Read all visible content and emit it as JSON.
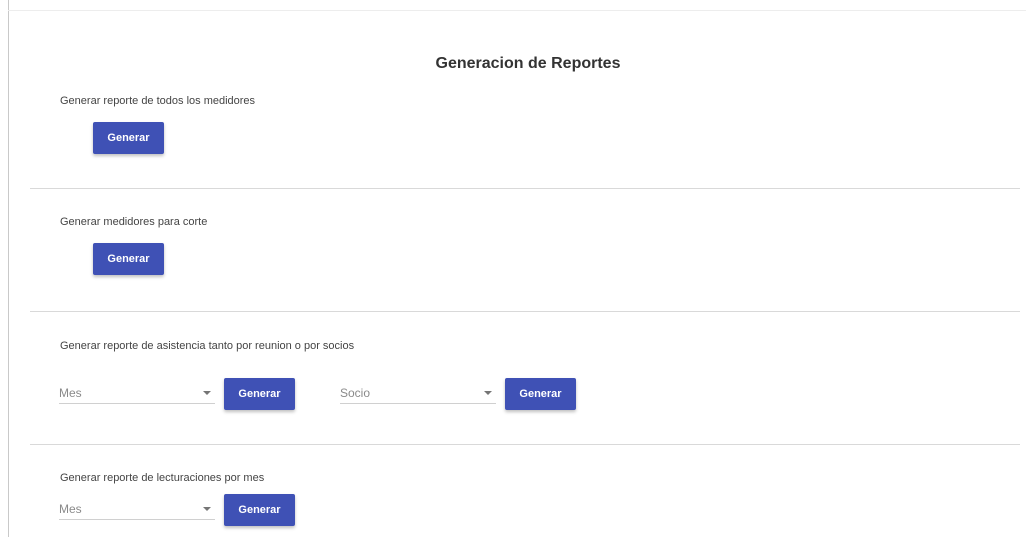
{
  "page": {
    "title": "Generacion de Reportes"
  },
  "sections": {
    "all_meters": {
      "label": "Generar reporte de todos los medidores",
      "button_label": "Generar"
    },
    "cut_meters": {
      "label": "Generar medidores para corte",
      "button_label": "Generar"
    },
    "attendance": {
      "label": "Generar reporte de asistencia tanto por reunion o por socios",
      "month_select": {
        "placeholder": "Mes",
        "icon": "arrow-drop-down-icon"
      },
      "month_button_label": "Generar",
      "member_select": {
        "placeholder": "Socio",
        "icon": "arrow-drop-down-icon"
      },
      "member_button_label": "Generar"
    },
    "readings": {
      "label": "Generar reporte de lecturaciones por mes",
      "month_select": {
        "placeholder": "Mes",
        "icon": "arrow-drop-down-icon"
      },
      "button_label": "Generar"
    }
  },
  "colors": {
    "primary_button": "#3f51b5",
    "button_text": "#ffffff",
    "divider": "#d9d9d9"
  }
}
